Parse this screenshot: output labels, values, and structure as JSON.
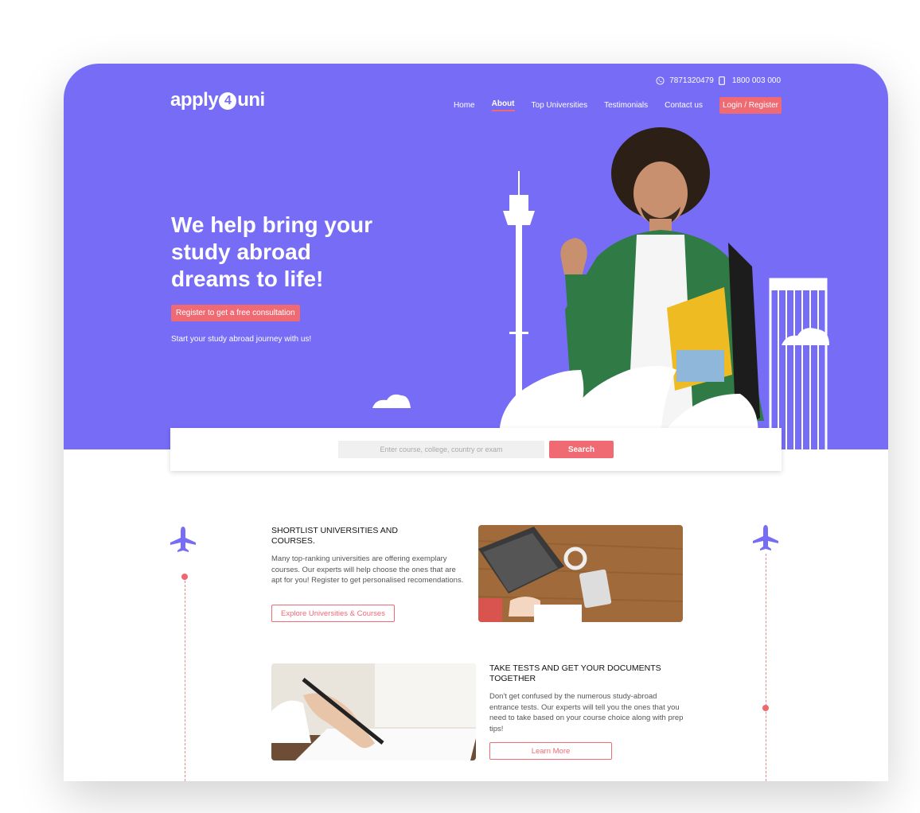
{
  "header": {
    "whatsapp_number": "7871320479",
    "phone_number": "1800 003 000",
    "logo_left": "apply",
    "logo_four": "4",
    "logo_right": "uni",
    "nav": {
      "home": "Home",
      "about": "About",
      "top_universities": "Top Universities",
      "testimonials": "Testimonials",
      "contact": "Contact us",
      "login": "Login / Register"
    }
  },
  "hero": {
    "headline": "We help bring your study abroad dreams to life!",
    "cta_label": "Register to get a free consultation",
    "subtext": "Start your study abroad journey with us!"
  },
  "search": {
    "placeholder": "Enter course, college, country or exam",
    "button_label": "Search"
  },
  "sections": {
    "shortlist": {
      "title": "SHORTLIST UNIVERSITIES AND COURSES.",
      "body": "Many top-ranking universities are offering exemplary courses. Our experts will help choose the ones that are apt for you! Register to get personalised recomendations.",
      "button_label": "Explore Universities & Courses"
    },
    "tests": {
      "title": "TAKE TESTS AND GET YOUR DOCUMENTS TOGETHER",
      "body": "Don't get confused by the numerous study-abroad entrance tests. Our experts will tell you the ones that you need to take based on your course choice along with prep tips!",
      "button_label": "Learn More"
    }
  },
  "colors": {
    "brand_purple": "#766cf6",
    "accent_coral": "#f06a73"
  },
  "icons": {
    "whatsapp": "whatsapp-icon",
    "phone": "mobile-phone-icon",
    "plane": "airplane-icon"
  }
}
